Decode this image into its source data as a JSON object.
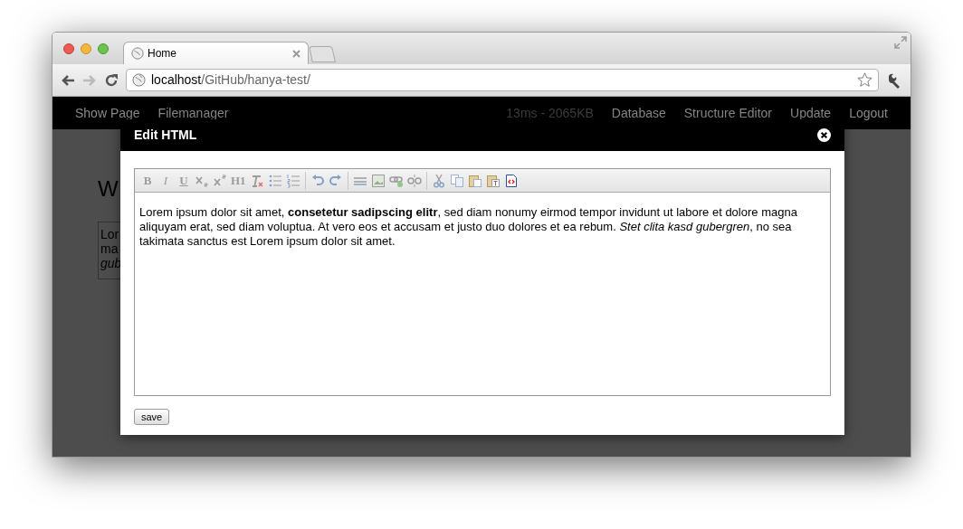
{
  "browser": {
    "tabs": [
      {
        "title": "Home",
        "selected": true
      }
    ],
    "url": {
      "host": "localhost",
      "path": "/GitHub/hanya-test/"
    }
  },
  "navbar": {
    "left": [
      "Show Page",
      "Filemanager"
    ],
    "stats": "13ms - 2065KB",
    "right": [
      "Database",
      "Structure Editor",
      "Update",
      "Logout"
    ]
  },
  "page": {
    "heading": "W",
    "box_lines": [
      "Lor",
      "ma",
      "gub"
    ]
  },
  "modal": {
    "title": "Edit HTML",
    "toolbar": [
      [
        {
          "kind": "glyph",
          "glyph": "B",
          "disabled": true
        },
        {
          "kind": "glyph",
          "glyph": "I",
          "disabled": true
        },
        {
          "kind": "glyph",
          "glyph": "U",
          "disabled": true
        },
        {
          "kind": "subscript",
          "disabled": true
        },
        {
          "kind": "superscript",
          "disabled": true
        },
        {
          "kind": "glyph",
          "glyph": "H1",
          "disabled": true
        },
        {
          "kind": "clear-format",
          "disabled": true
        },
        {
          "kind": "bullets",
          "disabled": true
        },
        {
          "kind": "numbers",
          "disabled": true
        }
      ],
      [
        {
          "kind": "undo",
          "disabled": true
        },
        {
          "kind": "redo",
          "disabled": true
        }
      ],
      [
        {
          "kind": "rule",
          "disabled": true
        },
        {
          "kind": "image",
          "disabled": true
        },
        {
          "kind": "link",
          "disabled": true
        },
        {
          "kind": "unlink",
          "disabled": true
        }
      ],
      [
        {
          "kind": "cut",
          "disabled": true
        },
        {
          "kind": "copy",
          "disabled": true
        },
        {
          "kind": "paste",
          "disabled": true
        },
        {
          "kind": "paste-text",
          "disabled": true
        },
        {
          "kind": "source",
          "disabled": false
        }
      ]
    ],
    "content": "Lorem ipsum dolor sit amet, **consetetur sadipscing elitr**, sed diam nonumy eirmod tempor invidunt ut labore et dolore magna aliquyam erat, sed diam voluptua. At vero eos et accusam et justo duo dolores et ea rebum. *Stet clita kasd gubergren*, no sea takimata sanctus est Lorem ipsum dolor sit amet.",
    "save_label": "save"
  }
}
